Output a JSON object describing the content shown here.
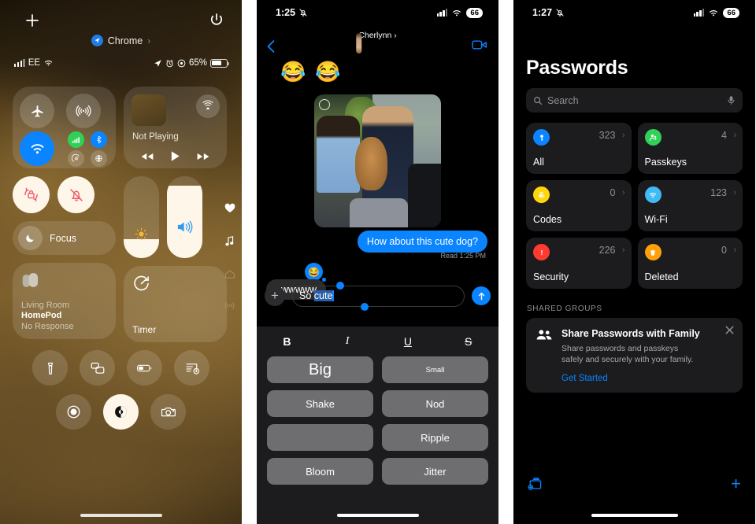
{
  "control_center": {
    "add_label": "+",
    "app_chip": {
      "name": "Chrome",
      "chevron": "›"
    },
    "status": {
      "carrier": "EE",
      "battery_pct": "65%"
    },
    "connectivity": {
      "airplane": "airplane-mode",
      "airdrop": "airdrop",
      "wifi": "wi-fi",
      "cellular": "cellular-data",
      "bluetooth": "bluetooth",
      "personal_hotspot": "personal-hotspot",
      "vpn": "vpn"
    },
    "media": {
      "status": "Not Playing",
      "airplay": "airplay"
    },
    "rotation_lock": "rotation-lock",
    "silent_mode": "silent-mode",
    "focus": {
      "label": "Focus"
    },
    "brightness": {
      "value": 22
    },
    "volume": {
      "value": 88
    },
    "home_tile": {
      "room": "Living Room",
      "device": "HomePod",
      "state": "No Response"
    },
    "timer_tile": {
      "label": "Timer"
    },
    "side_icons": [
      "heart-icon",
      "music-note-icon",
      "home-icon",
      "broadcast-icon"
    ],
    "shortcuts_row1": [
      "flashlight",
      "screen-mirroring",
      "low-power-mode",
      "new-note"
    ],
    "shortcuts_row2": [
      "screen-record",
      "dark-mode",
      "camera"
    ]
  },
  "messages": {
    "status": {
      "time": "1:25",
      "battery": "66",
      "mute_icon": "bell-slash-icon"
    },
    "contact": {
      "name": "Cherlynn",
      "chevron": "›"
    },
    "emoji_strip": "😂😂",
    "outgoing_bubble": "How about this cute dog?",
    "receipt": "Read 1:25 PM",
    "incoming_bubble": "awwwww",
    "tapback": "😂",
    "composer": {
      "plus": "+",
      "text_before": "So ",
      "text_selected": "cute",
      "send_icon": "send-arrow-icon"
    },
    "format_tools": [
      "B",
      "I",
      "U",
      "S"
    ],
    "effects": [
      {
        "label": "Big",
        "size": "big"
      },
      {
        "label": "Small",
        "size": "small"
      },
      {
        "label": "Shake",
        "size": "normal"
      },
      {
        "label": "Nod",
        "size": "normal"
      },
      {
        "label": "",
        "size": "normal"
      },
      {
        "label": "Ripple",
        "size": "normal"
      },
      {
        "label": "Bloom",
        "size": "normal"
      },
      {
        "label": "Jitter",
        "size": "normal"
      }
    ]
  },
  "passwords": {
    "status": {
      "time": "1:27",
      "battery": "66",
      "mute_icon": "bell-slash-icon"
    },
    "title": "Passwords",
    "search": {
      "placeholder": "Search",
      "mic_icon": "microphone-icon"
    },
    "categories": [
      {
        "label": "All",
        "count": "323",
        "icon": "key-icon",
        "color": "#0a84ff"
      },
      {
        "label": "Passkeys",
        "count": "4",
        "icon": "person-key-icon",
        "color": "#30d158"
      },
      {
        "label": "Codes",
        "count": "0",
        "icon": "lock-clock-icon",
        "color": "#ffd60a"
      },
      {
        "label": "Wi-Fi",
        "count": "123",
        "icon": "wifi-icon",
        "color": "#41b9f5"
      },
      {
        "label": "Security",
        "count": "226",
        "icon": "warning-icon",
        "color": "#ff3b30"
      },
      {
        "label": "Deleted",
        "count": "0",
        "icon": "trash-icon",
        "color": "#ff9f0a"
      }
    ],
    "section_header": "SHARED GROUPS",
    "banner": {
      "title": "Share Passwords with Family",
      "body": "Share passwords and passkeys safely and securely with your family.",
      "cta": "Get Started",
      "close_icon": "close-icon",
      "lead_icon": "people-icon"
    },
    "toolbar": {
      "left_icon": "import-passwords-icon",
      "right_label": "+"
    }
  }
}
